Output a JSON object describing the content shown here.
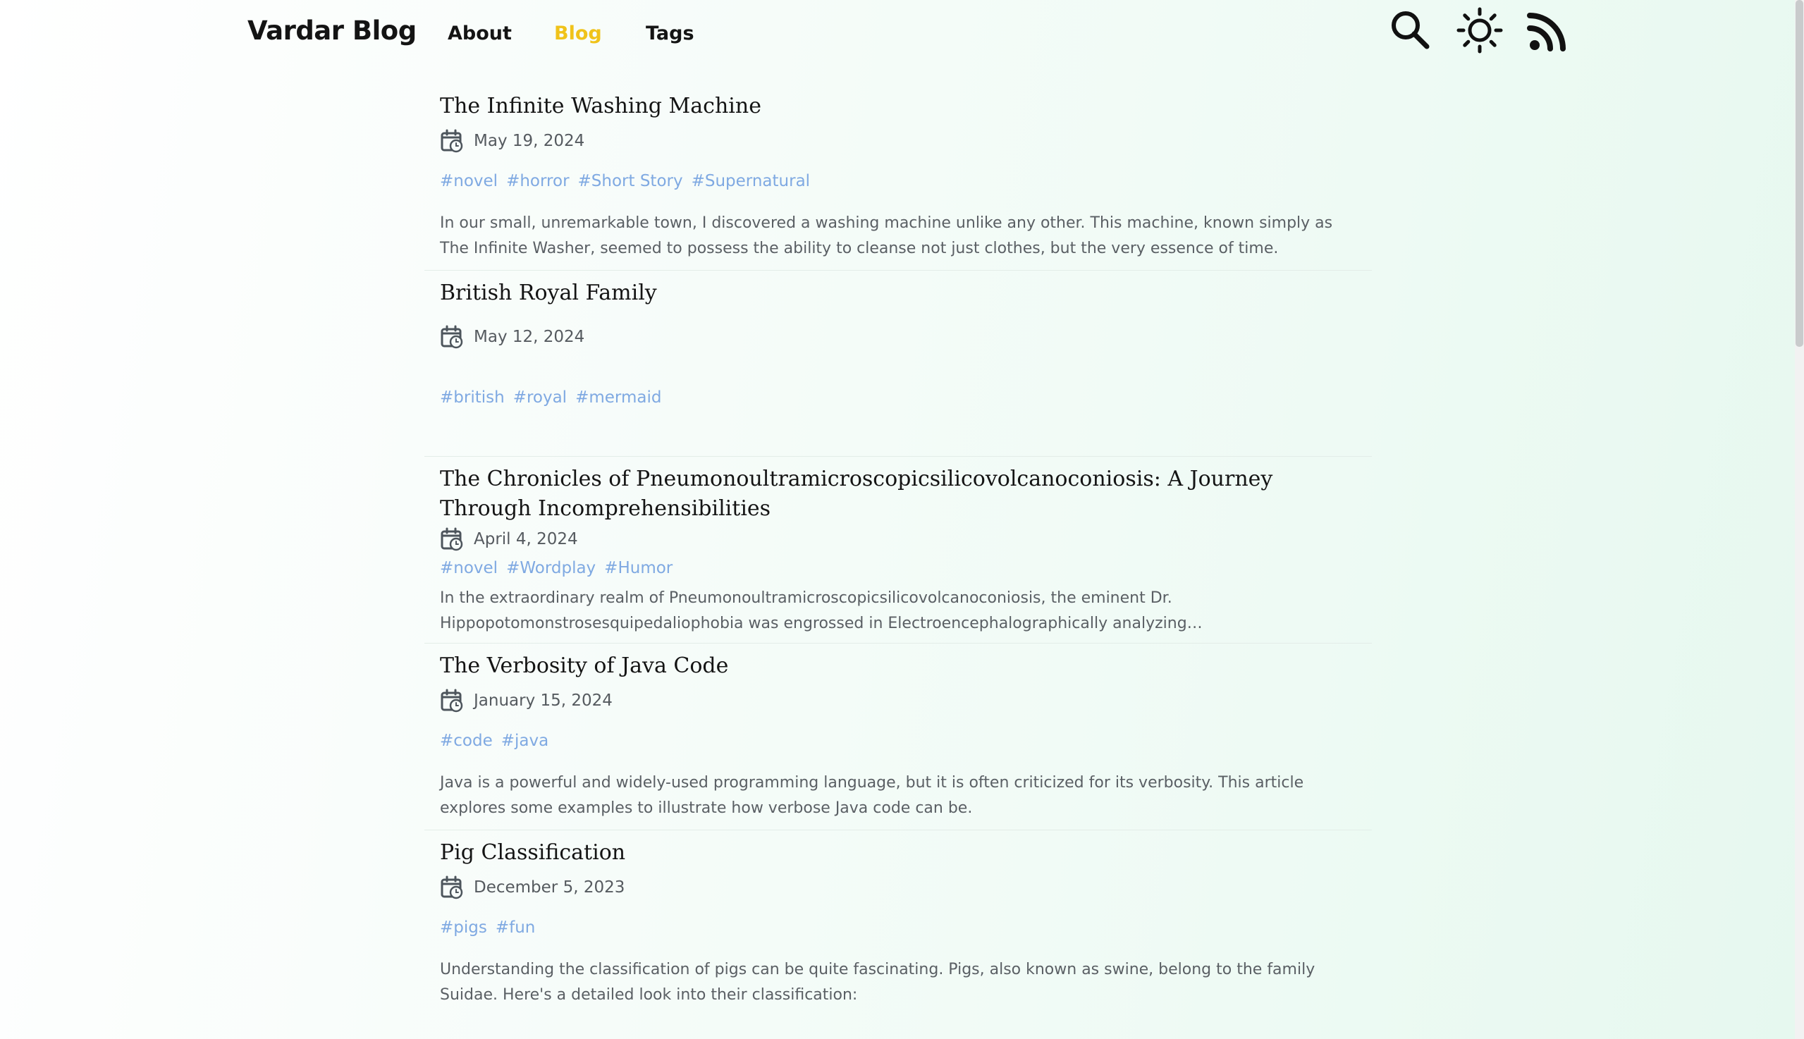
{
  "header": {
    "brand": "Vardar Blog",
    "nav": {
      "about": "About",
      "blog": "Blog",
      "tags": "Tags"
    },
    "icons": {
      "search": "search-icon",
      "theme": "sun-icon",
      "rss": "rss-icon"
    },
    "active_color": "#f0c31a"
  },
  "posts": [
    {
      "title": "The Infinite Washing Machine",
      "date": "May 19, 2024",
      "tags": [
        "#novel",
        "#horror",
        "#Short Story",
        "#Supernatural"
      ],
      "excerpt": "In our small, unremarkable town, I discovered a washing machine unlike any other. This machine, known simply as The Infinite Washer, seemed to possess the ability to cleanse not just clothes, but the very essence of time."
    },
    {
      "title": "British Royal Family",
      "date": "May 12, 2024",
      "tags": [
        "#british",
        "#royal",
        "#mermaid"
      ],
      "excerpt": ""
    },
    {
      "title": "The Chronicles of Pneumonoultramicroscopicsilicovolcanoconiosis: A Journey Through Incomprehensibilities",
      "date": "April 4, 2024",
      "tags": [
        "#novel",
        "#Wordplay",
        "#Humor"
      ],
      "excerpt": "In the extraordinary realm of Pneumonoultramicroscopicsilicovolcanoconiosis, the eminent Dr. Hippopotomonstrosesquipedaliophobia was engrossed in Electroencephalographically analyzing…"
    },
    {
      "title": "The Verbosity of Java Code",
      "date": "January 15, 2024",
      "tags": [
        "#code",
        "#java"
      ],
      "excerpt": "Java is a powerful and widely-used programming language, but it is often criticized for its verbosity. This article explores some examples to illustrate how verbose Java code can be."
    },
    {
      "title": "Pig Classification",
      "date": "December 5, 2023",
      "tags": [
        "#pigs",
        "#fun"
      ],
      "excerpt": "Understanding the classification of pigs can be quite fascinating. Pigs, also known as swine, belong to the family Suidae. Here's a detailed look into their classification:"
    }
  ]
}
